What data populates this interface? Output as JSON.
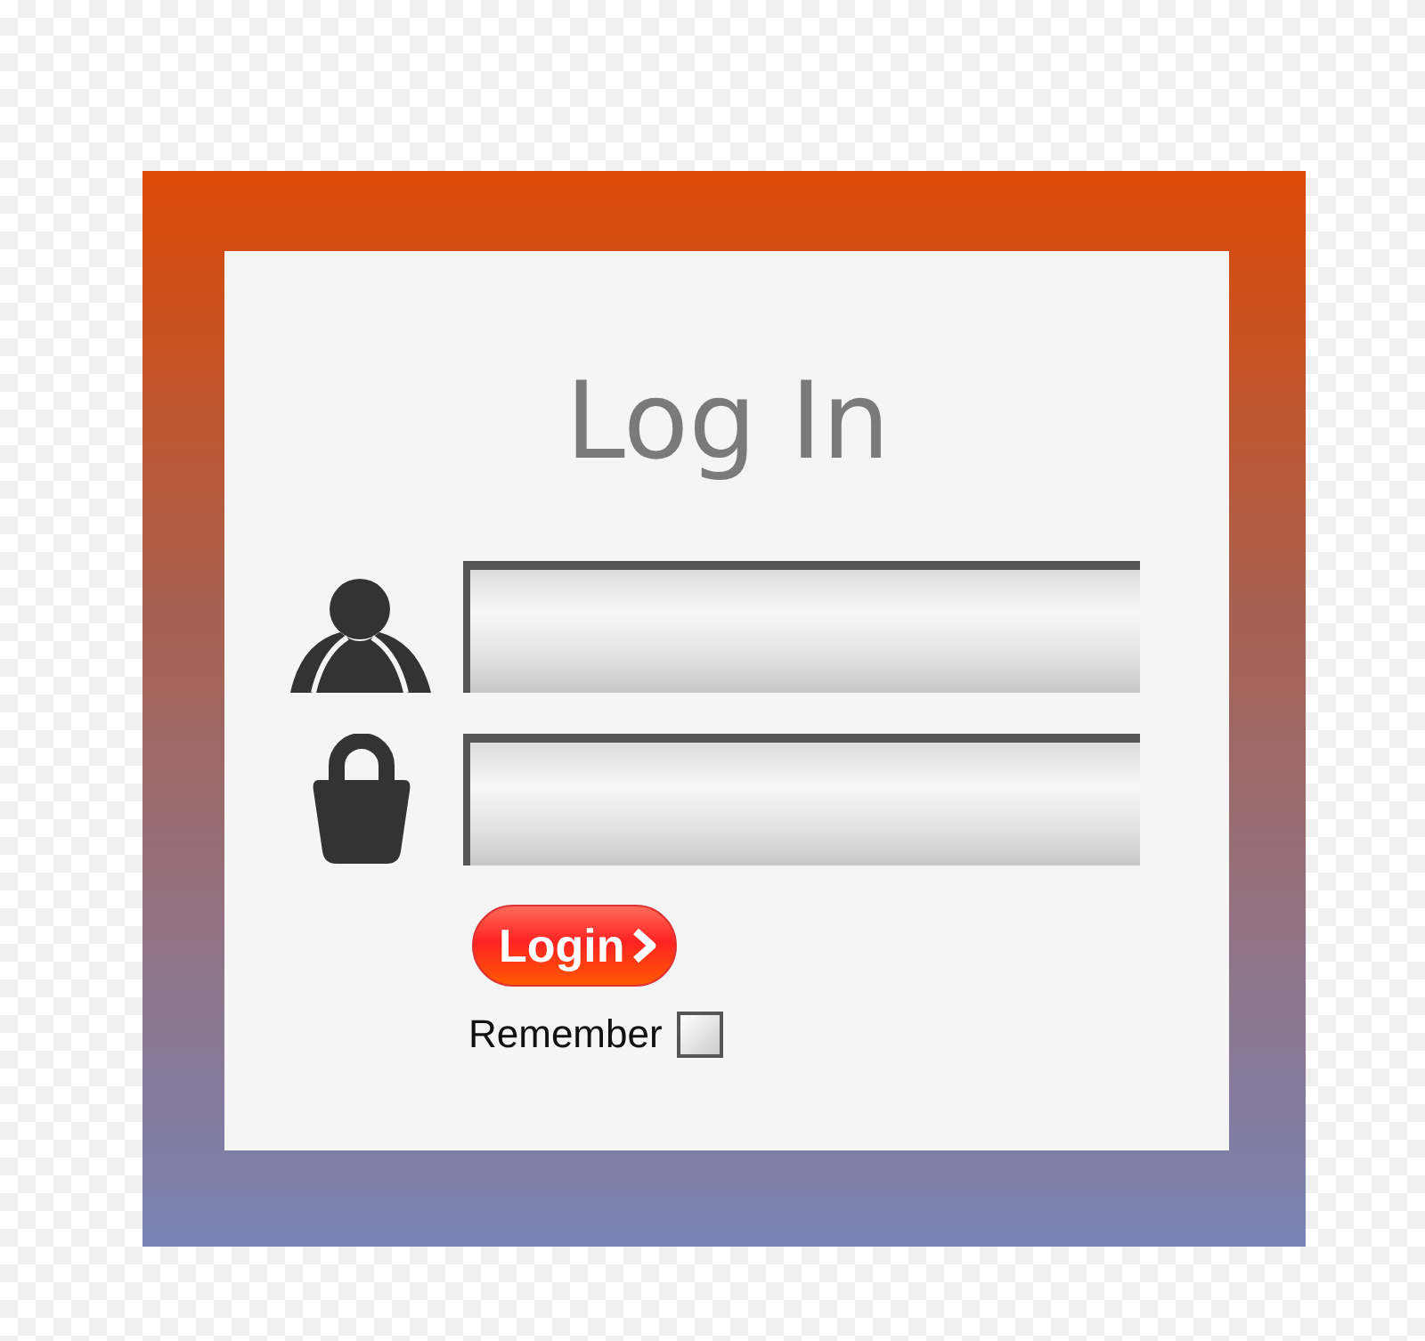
{
  "title": "Log In",
  "fields": [
    {
      "kind": "user"
    },
    {
      "kind": "password"
    }
  ],
  "login_button": {
    "label": "Login"
  },
  "remember": {
    "label": "Remember",
    "checked": false
  }
}
